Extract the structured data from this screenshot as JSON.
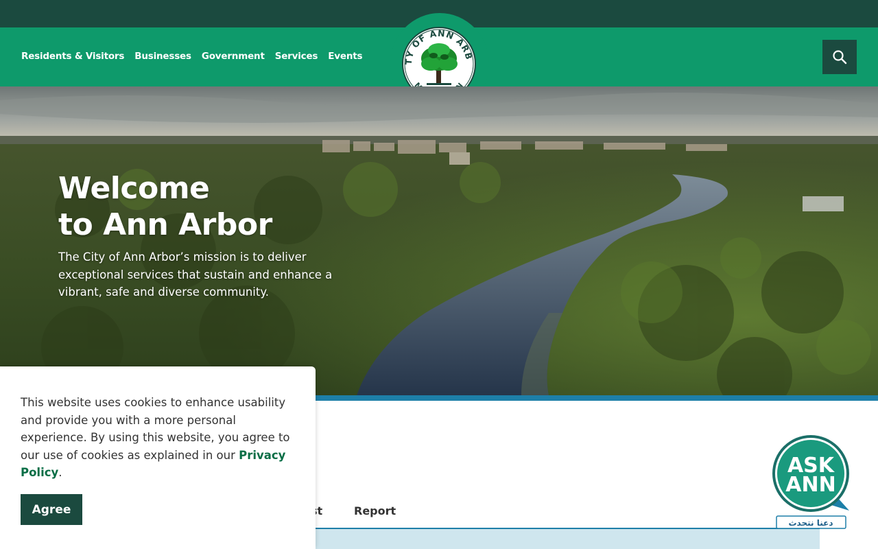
{
  "header": {
    "nav": [
      {
        "label": "Residents & Visitors"
      },
      {
        "label": "Businesses"
      },
      {
        "label": "Government"
      },
      {
        "label": "Services"
      },
      {
        "label": "Events"
      }
    ],
    "logo": {
      "top_text": "CITY OF ANN ARBOR",
      "bottom_text": "MICHIGAN",
      "icon": "oak-tree-seal-icon"
    },
    "search_icon": "search-icon"
  },
  "hero": {
    "title_line1": "Welcome",
    "title_line2": "to Ann Arbor",
    "mission": "The City of Ann Arbor’s mission is to deliver exceptional services that sustain and enhance a vibrant, safe and diverse community."
  },
  "tabs": [
    {
      "label": "st"
    },
    {
      "label": "Report"
    }
  ],
  "ask_ann": {
    "label_line1": "ASK",
    "label_line2": "ANN",
    "tagline": "دعنا نتحدث"
  },
  "cookie_banner": {
    "text_before": "This website uses cookies to enhance usability and provide you with a more personal experience. By using this website, you agree to our use of cookies as explained in our ",
    "link_label": "Privacy Policy",
    "text_after": ".",
    "agree_label": "Agree"
  },
  "colors": {
    "brand_green": "#0e9a6b",
    "dark_green": "#1b4a3f",
    "accent_blue": "#1d7fa8",
    "link_green": "#0a6e46"
  }
}
